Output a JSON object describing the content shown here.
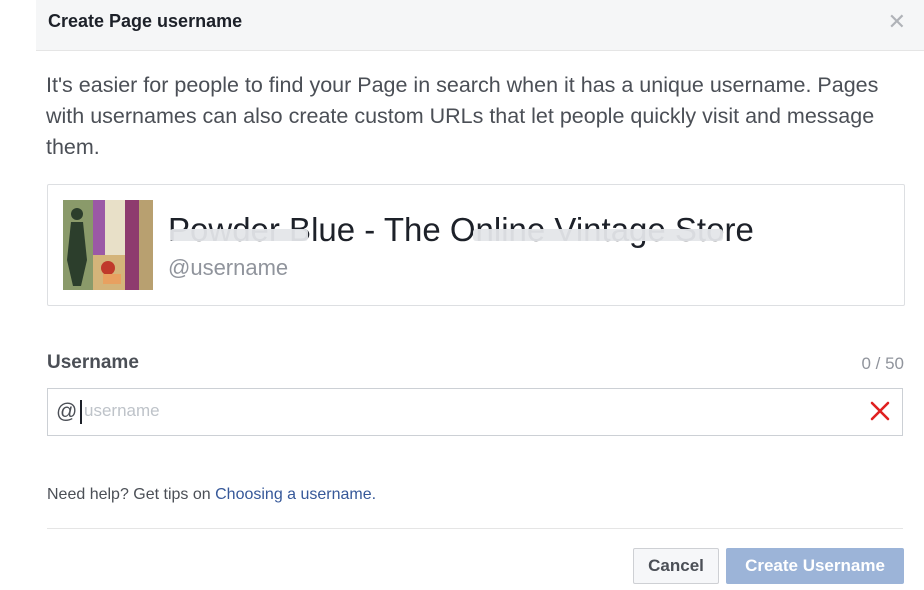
{
  "dialog": {
    "title": "Create Page username",
    "close_icon": "close-icon",
    "description": "It's easier for people to find your Page in search when it has a unique username. Pages with usernames can also create custom URLs that let people quickly visit and message them."
  },
  "page_card": {
    "name": "Powder Blue - The Online Vintage Store",
    "handle": "@username"
  },
  "username_field": {
    "label": "Username",
    "char_count": "0 / 50",
    "prefix": "@",
    "value": "",
    "placeholder": "username",
    "clear_icon": "clear-x-icon",
    "clear_color": "#e02020"
  },
  "help": {
    "text": "Need help? Get tips on ",
    "link_text": "Choosing a username."
  },
  "footer": {
    "cancel_label": "Cancel",
    "create_label": "Create Username"
  },
  "colors": {
    "link": "#365899",
    "primary_disabled": "#9cb4d8"
  }
}
